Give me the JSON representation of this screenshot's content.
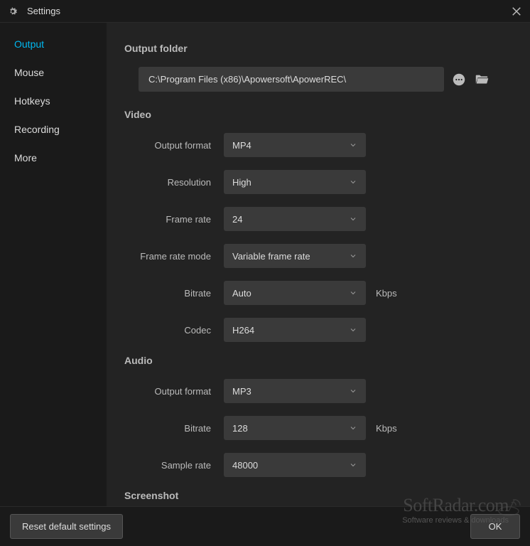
{
  "titlebar": {
    "title": "Settings"
  },
  "sidebar": {
    "items": [
      {
        "label": "Output",
        "active": true
      },
      {
        "label": "Mouse",
        "active": false
      },
      {
        "label": "Hotkeys",
        "active": false
      },
      {
        "label": "Recording",
        "active": false
      },
      {
        "label": "More",
        "active": false
      }
    ]
  },
  "sections": {
    "output_folder": {
      "header": "Output folder",
      "path": "C:\\Program Files (x86)\\Apowersoft\\ApowerREC\\"
    },
    "video": {
      "header": "Video",
      "output_format": {
        "label": "Output format",
        "value": "MP4"
      },
      "resolution": {
        "label": "Resolution",
        "value": "High"
      },
      "frame_rate": {
        "label": "Frame rate",
        "value": "24"
      },
      "frame_rate_mode": {
        "label": "Frame rate mode",
        "value": "Variable frame rate"
      },
      "bitrate": {
        "label": "Bitrate",
        "value": "Auto",
        "suffix": "Kbps"
      },
      "codec": {
        "label": "Codec",
        "value": "H264"
      }
    },
    "audio": {
      "header": "Audio",
      "output_format": {
        "label": "Output format",
        "value": "MP3"
      },
      "bitrate": {
        "label": "Bitrate",
        "value": "128",
        "suffix": "Kbps"
      },
      "sample_rate": {
        "label": "Sample rate",
        "value": "48000"
      }
    },
    "screenshot": {
      "header": "Screenshot"
    }
  },
  "footer": {
    "reset": "Reset default settings",
    "ok": "OK"
  },
  "watermark": {
    "main": "SoftRadar.com",
    "sub": "Software reviews & downloads"
  }
}
